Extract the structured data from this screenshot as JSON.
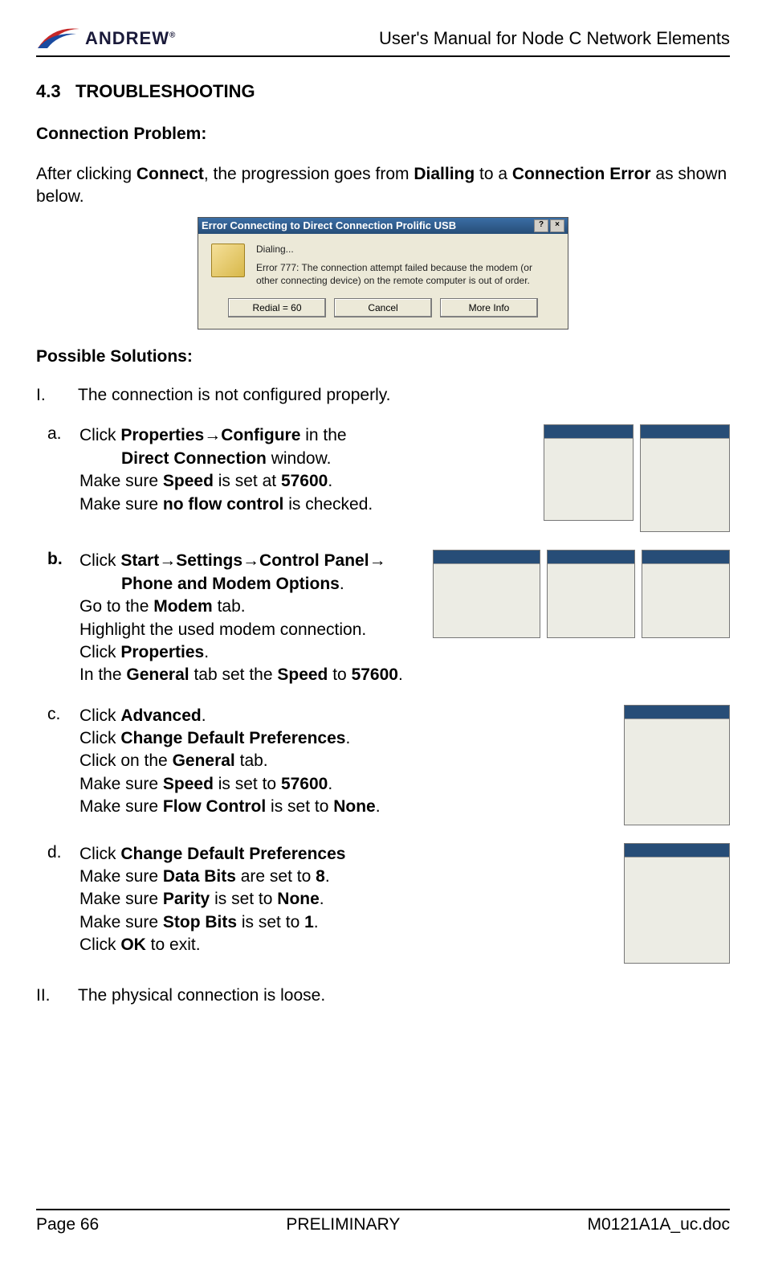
{
  "header": {
    "logo_text": "ANDREW",
    "logo_reg": "®",
    "title": "User's Manual for Node C Network Elements"
  },
  "section": {
    "number": "4.3",
    "title": "TROUBLESHOOTING"
  },
  "connection_problem": {
    "heading": "Connection Problem:",
    "intro_prefix": "After clicking ",
    "intro_word1": "Connect",
    "intro_mid1": ", the progression goes from ",
    "intro_word2": "Dialling",
    "intro_mid2": " to a ",
    "intro_word3": "Connection Error",
    "intro_suffix": " as shown below."
  },
  "dialog": {
    "title": "Error Connecting to Direct Connection Prolific USB",
    "help_btn": "?",
    "close_btn": "×",
    "status": "Dialing...",
    "error_msg": "Error 777: The connection attempt failed because the modem (or other connecting device) on the remote computer is out of order.",
    "btn_redial": "Redial = 60",
    "btn_cancel": "Cancel",
    "btn_more": "More Info"
  },
  "solutions": {
    "heading": "Possible Solutions:",
    "I": {
      "marker": "I.",
      "text": "The connection is not configured properly."
    },
    "a": {
      "marker": "a.",
      "l1_pre": "Click ",
      "l1_b1": "Properties",
      "l1_arrow": "→",
      "l1_b2": "Configure",
      "l1_post": " in the",
      "l2_b": "Direct Connection",
      "l2_post": " window.",
      "l3_pre": "Make sure ",
      "l3_b1": "Speed",
      "l3_mid": " is set at ",
      "l3_b2": "57600",
      "l3_post": ".",
      "l4_pre": "Make sure ",
      "l4_b": "no flow control",
      "l4_post": " is checked."
    },
    "b": {
      "marker": "b.",
      "l1_pre": "Click ",
      "l1_b1": "Start",
      "l1_a1": "→",
      "l1_b2": "Settings",
      "l1_a2": "→",
      "l1_b3": "Control Panel",
      "l1_a3": "→",
      "l2_b": "Phone and Modem Options",
      "l2_post": ".",
      "l3_pre": "Go to the ",
      "l3_b": "Modem",
      "l3_post": " tab.",
      "l4": "Highlight the used modem connection.",
      "l5_pre": "Click ",
      "l5_b": "Properties",
      "l5_post": ".",
      "l6_pre": "In the ",
      "l6_b1": "General",
      "l6_mid1": " tab set the ",
      "l6_b2": "Speed",
      "l6_mid2": " to ",
      "l6_b3": "57600",
      "l6_post": "."
    },
    "c": {
      "marker": "c.",
      "l1_pre": "Click ",
      "l1_b": "Advanced",
      "l1_post": ".",
      "l2_pre": "Click ",
      "l2_b": "Change Default Preferences",
      "l2_post": ".",
      "l3_pre": "Click on the ",
      "l3_b": "General",
      "l3_post": " tab.",
      "l4_pre": "Make sure ",
      "l4_b1": "Speed",
      "l4_mid": " is set to ",
      "l4_b2": "57600",
      "l4_post": ".",
      "l5_pre": "Make sure ",
      "l5_b1": "Flow Control",
      "l5_mid": " is set to ",
      "l5_b2": "None",
      "l5_post": "."
    },
    "d": {
      "marker": "d.",
      "l1_pre": "Click ",
      "l1_b": "Change Default Preferences",
      "l2_pre": "Make sure ",
      "l2_b1": "Data Bits",
      "l2_mid": " are set to ",
      "l2_b2": "8",
      "l2_post": ".",
      "l3_pre": "Make sure ",
      "l3_b1": "Parity",
      "l3_mid": " is set to ",
      "l3_b2": "None",
      "l3_post": ".",
      "l4_pre": "Make sure ",
      "l4_b1": "Stop Bits",
      "l4_mid": " is set to ",
      "l4_b2": "1",
      "l4_post": ".",
      "l5_pre": "Click ",
      "l5_b": "OK",
      "l5_post": " to exit."
    },
    "II": {
      "marker": "II.",
      "text": "The physical connection is loose."
    }
  },
  "footer": {
    "left": "Page 66",
    "center": "PRELIMINARY",
    "right": "M0121A1A_uc.doc"
  }
}
